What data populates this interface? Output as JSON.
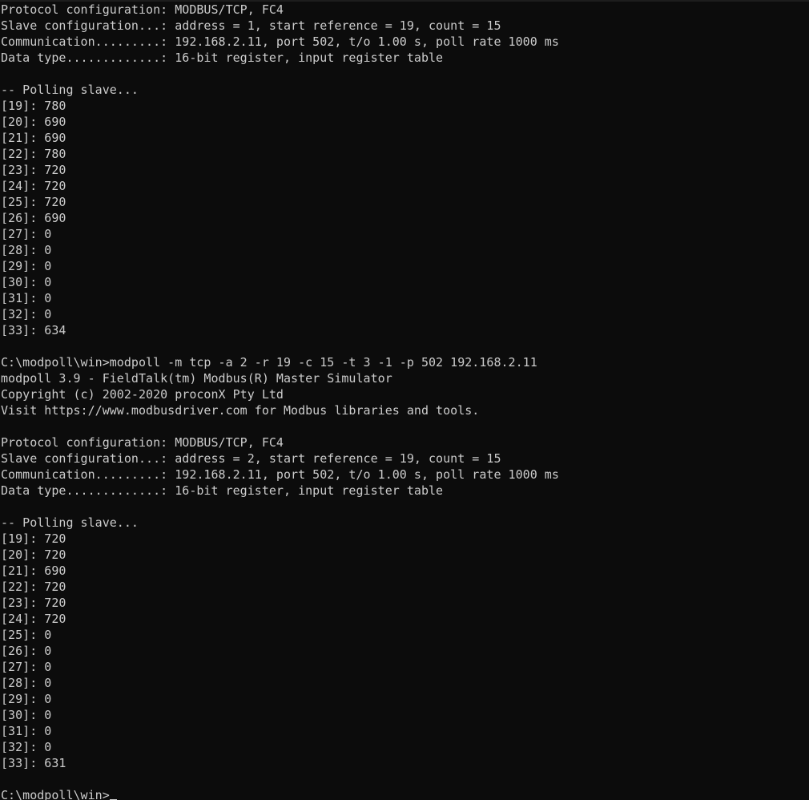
{
  "window": {
    "type": "windows-command-prompt",
    "background_color": "#0c0c0c",
    "foreground_color": "#cccccc",
    "prompt": "C:\\modpoll\\win>",
    "cursor_glyph": "_"
  },
  "session": {
    "blocks": [
      {
        "id": "poll-block-1",
        "header": {
          "protocol_configuration_label": "Protocol configuration:",
          "protocol_configuration_value": "MODBUS/TCP, FC4",
          "slave_configuration_label": "Slave configuration...:",
          "slave_configuration_value": "address = 1, start reference = 19, count = 15",
          "communication_label": "Communication.........:",
          "communication_value": "192.168.2.11, port 502, t/o 1.00 s, poll rate 1000 ms",
          "data_type_label": "Data type.............:",
          "data_type_value": "16-bit register, input register table"
        },
        "polling_status": "-- Polling slave...",
        "registers": [
          {
            "index": "[19]:",
            "value": "780"
          },
          {
            "index": "[20]:",
            "value": "690"
          },
          {
            "index": "[21]:",
            "value": "690"
          },
          {
            "index": "[22]:",
            "value": "780"
          },
          {
            "index": "[23]:",
            "value": "720"
          },
          {
            "index": "[24]:",
            "value": "720"
          },
          {
            "index": "[25]:",
            "value": "720"
          },
          {
            "index": "[26]:",
            "value": "690"
          },
          {
            "index": "[27]:",
            "value": "0"
          },
          {
            "index": "[28]:",
            "value": "0"
          },
          {
            "index": "[29]:",
            "value": "0"
          },
          {
            "index": "[30]:",
            "value": "0"
          },
          {
            "index": "[31]:",
            "value": "0"
          },
          {
            "index": "[32]:",
            "value": "0"
          },
          {
            "index": "[33]:",
            "value": "634"
          }
        ]
      },
      {
        "id": "poll-block-2",
        "command_line": {
          "prompt": "C:\\modpoll\\win>",
          "command": "modpoll -m tcp -a 2 -r 19 -c 15 -t 3 -1 -p 502 192.168.2.11"
        },
        "banner": {
          "version_line": "modpoll 3.9 - FieldTalk(tm) Modbus(R) Master Simulator",
          "copyright_line": "Copyright (c) 2002-2020 proconX Pty Ltd",
          "visit_line": "Visit https://www.modbusdriver.com for Modbus libraries and tools."
        },
        "header": {
          "protocol_configuration_label": "Protocol configuration:",
          "protocol_configuration_value": "MODBUS/TCP, FC4",
          "slave_configuration_label": "Slave configuration...:",
          "slave_configuration_value": "address = 2, start reference = 19, count = 15",
          "communication_label": "Communication.........:",
          "communication_value": "192.168.2.11, port 502, t/o 1.00 s, poll rate 1000 ms",
          "data_type_label": "Data type.............:",
          "data_type_value": "16-bit register, input register table"
        },
        "polling_status": "-- Polling slave...",
        "registers": [
          {
            "index": "[19]:",
            "value": "720"
          },
          {
            "index": "[20]:",
            "value": "720"
          },
          {
            "index": "[21]:",
            "value": "690"
          },
          {
            "index": "[22]:",
            "value": "720"
          },
          {
            "index": "[23]:",
            "value": "720"
          },
          {
            "index": "[24]:",
            "value": "720"
          },
          {
            "index": "[25]:",
            "value": "0"
          },
          {
            "index": "[26]:",
            "value": "0"
          },
          {
            "index": "[27]:",
            "value": "0"
          },
          {
            "index": "[28]:",
            "value": "0"
          },
          {
            "index": "[29]:",
            "value": "0"
          },
          {
            "index": "[30]:",
            "value": "0"
          },
          {
            "index": "[31]:",
            "value": "0"
          },
          {
            "index": "[32]:",
            "value": "0"
          },
          {
            "index": "[33]:",
            "value": "631"
          }
        ]
      }
    ],
    "final_prompt": "C:\\modpoll\\win>"
  }
}
